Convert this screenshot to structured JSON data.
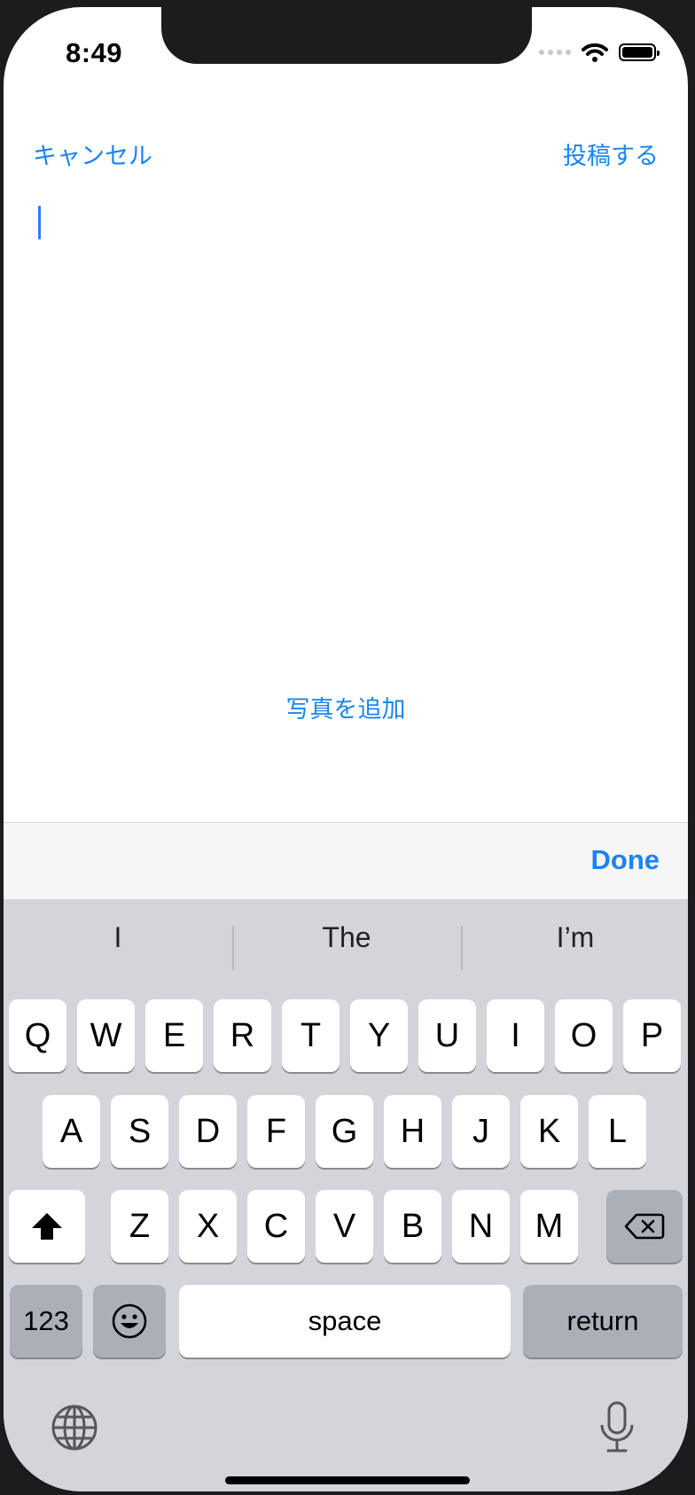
{
  "status_bar": {
    "time": "8:49"
  },
  "nav": {
    "cancel_label": "キャンセル",
    "post_label": "投稿する"
  },
  "compose": {
    "add_photo_label": "写真を追加"
  },
  "toolbar": {
    "done_label": "Done"
  },
  "suggestions": [
    "I",
    "The",
    "I’m"
  ],
  "keyboard": {
    "row1": [
      "Q",
      "W",
      "E",
      "R",
      "T",
      "Y",
      "U",
      "I",
      "O",
      "P"
    ],
    "row2": [
      "A",
      "S",
      "D",
      "F",
      "G",
      "H",
      "J",
      "K",
      "L"
    ],
    "row3": [
      "Z",
      "X",
      "C",
      "V",
      "B",
      "N",
      "M"
    ],
    "numbers_label": "123",
    "space_label": "space",
    "return_label": "return",
    "shift_icon": "shift-icon",
    "delete_icon": "delete-icon",
    "emoji_icon": "emoji-icon",
    "globe_icon": "globe-icon",
    "mic_icon": "microphone-icon"
  },
  "colors": {
    "accent": "#1a84f0",
    "keyboard_bg": "#d3d5db",
    "key_dark": "#abafb8"
  }
}
